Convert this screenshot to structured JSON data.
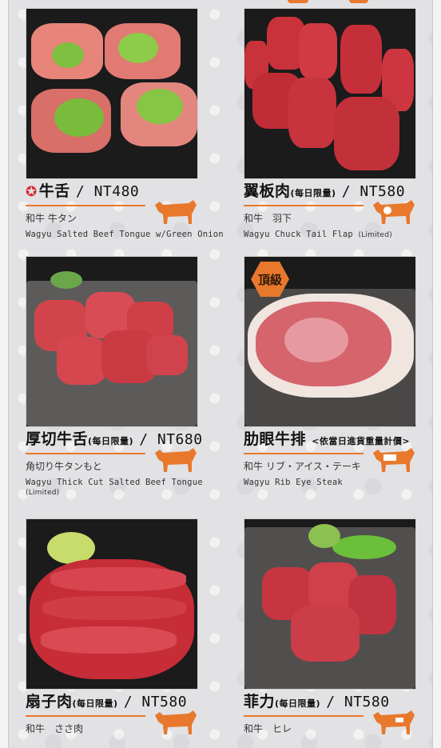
{
  "menu": {
    "items": [
      {
        "name": "牛舌",
        "qualifier": "",
        "price": "/ NT480",
        "jp": "和牛 牛タン",
        "en": "Wagyu Salted Beef Tongue w/Green Onion",
        "en_suffix": "",
        "en_line2": "",
        "favorite": true,
        "badge": "",
        "cow_icon": "cow-icon"
      },
      {
        "name": "翼板肉",
        "qualifier": "(每日限量)",
        "price": "/ NT580",
        "jp": "和牛　羽下",
        "en": "Wagyu Chuck Tail Flap ",
        "en_suffix": "(Limited)",
        "en_line2": "",
        "favorite": false,
        "badge": "",
        "cow_icon": "cow-icon-chuck"
      },
      {
        "name": "厚切牛舌",
        "qualifier": "(每日限量)",
        "price": "/ NT680",
        "jp": "角切り牛タンもと",
        "en": "Wagyu Thick Cut Salted Beef Tongue",
        "en_suffix": "",
        "en_line2": "(Limited)",
        "favorite": false,
        "badge": "",
        "cow_icon": "cow-icon"
      },
      {
        "name": "肋眼牛排",
        "qualifier": "",
        "price": "",
        "note": "<依當日進貨重量計價>",
        "jp": "和牛 リブ・アイス・テーキ",
        "en": "Wagyu Rib Eye Steak",
        "en_suffix": "",
        "en_line2": "",
        "favorite": false,
        "badge": "頂級",
        "cow_icon": "cow-icon-ribeye"
      },
      {
        "name": "扇子肉",
        "qualifier": "(每日限量)",
        "price": "/ NT580",
        "jp": "和牛　ささ肉",
        "en": "",
        "en_suffix": "",
        "en_line2": "",
        "favorite": false,
        "badge": "",
        "cow_icon": "cow-icon"
      },
      {
        "name": "菲力",
        "qualifier": "(每日限量)",
        "price": "/ NT580",
        "jp": "和牛　ヒレ",
        "en": "",
        "en_suffix": "",
        "en_line2": "",
        "favorite": false,
        "badge": "",
        "cow_icon": "cow-icon-fillet"
      }
    ]
  },
  "colors": {
    "accent": "#e8782c",
    "favorite": "#d8262b",
    "text": "#111111"
  }
}
